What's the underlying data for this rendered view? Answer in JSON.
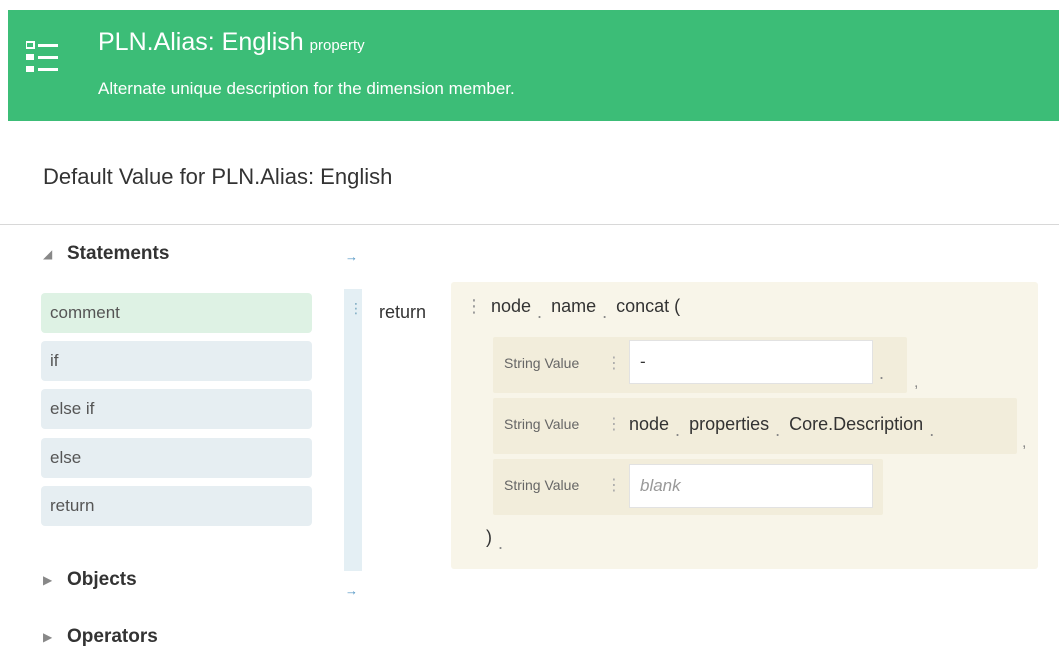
{
  "header": {
    "title": "PLN.Alias: English",
    "kind": "property",
    "description": "Alternate unique description for the dimension member.",
    "icon": "list-icon",
    "color": "#3cbd77"
  },
  "page_heading": "Default Value for PLN.Alias: English",
  "palette": {
    "statements_label": "Statements",
    "statements": [
      "comment",
      "if",
      "else if",
      "else",
      "return"
    ],
    "objects_label": "Objects",
    "operators_label": "Operators"
  },
  "editor": {
    "return_keyword": "return",
    "chain": [
      "node",
      "name",
      "concat ("
    ],
    "params": [
      {
        "label": "String Value",
        "value": "-"
      },
      {
        "label": "String Value",
        "chain": [
          "node",
          "properties",
          "Core.Description"
        ]
      },
      {
        "label": "String Value",
        "placeholder": "blank"
      }
    ],
    "close_paren": ")"
  }
}
